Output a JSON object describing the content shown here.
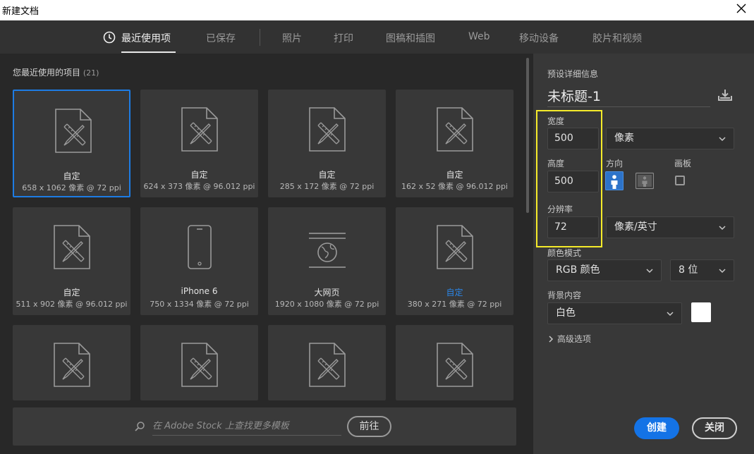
{
  "window": {
    "title": "新建文档"
  },
  "tabs": [
    {
      "label": "最近使用项"
    },
    {
      "label": "已保存"
    },
    {
      "label": "照片"
    },
    {
      "label": "打印"
    },
    {
      "label": "图稿和插图"
    },
    {
      "label": "Web"
    },
    {
      "label": "移动设备"
    },
    {
      "label": "胶片和视频"
    }
  ],
  "recent": {
    "title": "您最近使用的项目",
    "count": "(21)",
    "items": [
      {
        "name": "自定",
        "size": "658 x 1062 像素 @ 72 ppi",
        "icon": "document-ruler-icon"
      },
      {
        "name": "自定",
        "size": "624 x 373 像素 @ 96.012 ppi",
        "icon": "document-ruler-icon"
      },
      {
        "name": "自定",
        "size": "285 x 172 像素 @ 72 ppi",
        "icon": "document-ruler-icon"
      },
      {
        "name": "自定",
        "size": "162 x 52 像素 @ 96.012 ppi",
        "icon": "document-ruler-icon"
      },
      {
        "name": "自定",
        "size": "511 x 902 像素 @ 96.012 ppi",
        "icon": "document-ruler-icon"
      },
      {
        "name": "iPhone 6",
        "size": "750 x 1334 像素 @ 72 ppi",
        "icon": "phone-icon"
      },
      {
        "name": "大网页",
        "size": "1920 x 1080 像素 @ 72 ppi",
        "icon": "web-browser-icon"
      },
      {
        "name": "自定",
        "size": "380 x 271 像素 @ 72 ppi",
        "icon": "document-ruler-icon"
      },
      {
        "name": "",
        "size": "",
        "icon": "document-ruler-icon"
      },
      {
        "name": "",
        "size": "",
        "icon": "document-ruler-icon"
      },
      {
        "name": "",
        "size": "",
        "icon": "document-ruler-icon"
      },
      {
        "name": "",
        "size": "",
        "icon": "document-ruler-icon"
      }
    ]
  },
  "stock": {
    "placeholder": "在 Adobe Stock 上查找更多模板",
    "go_label": "前往"
  },
  "preset": {
    "section_title": "预设详细信息",
    "doc_name": "未标题-1",
    "width_label": "宽度",
    "width_value": "500",
    "unit": "像素",
    "height_label": "高度",
    "height_value": "500",
    "orientation_label": "方向",
    "artboard_label": "画板",
    "artboard_checked": false,
    "resolution_label": "分辨率",
    "resolution_value": "72",
    "resolution_unit": "像素/英寸",
    "color_mode_label": "颜色模式",
    "color_mode": "RGB 颜色",
    "bit_depth": "8 位",
    "background_label": "背景内容",
    "background": "白色",
    "background_color": "#ffffff",
    "advanced_label": "高级选项"
  },
  "actions": {
    "create_label": "创建",
    "close_label": "关闭"
  },
  "colors": {
    "accent": "#1473e6",
    "highlight": "#f5eb2a",
    "selected_border": "#1d7ce4"
  }
}
